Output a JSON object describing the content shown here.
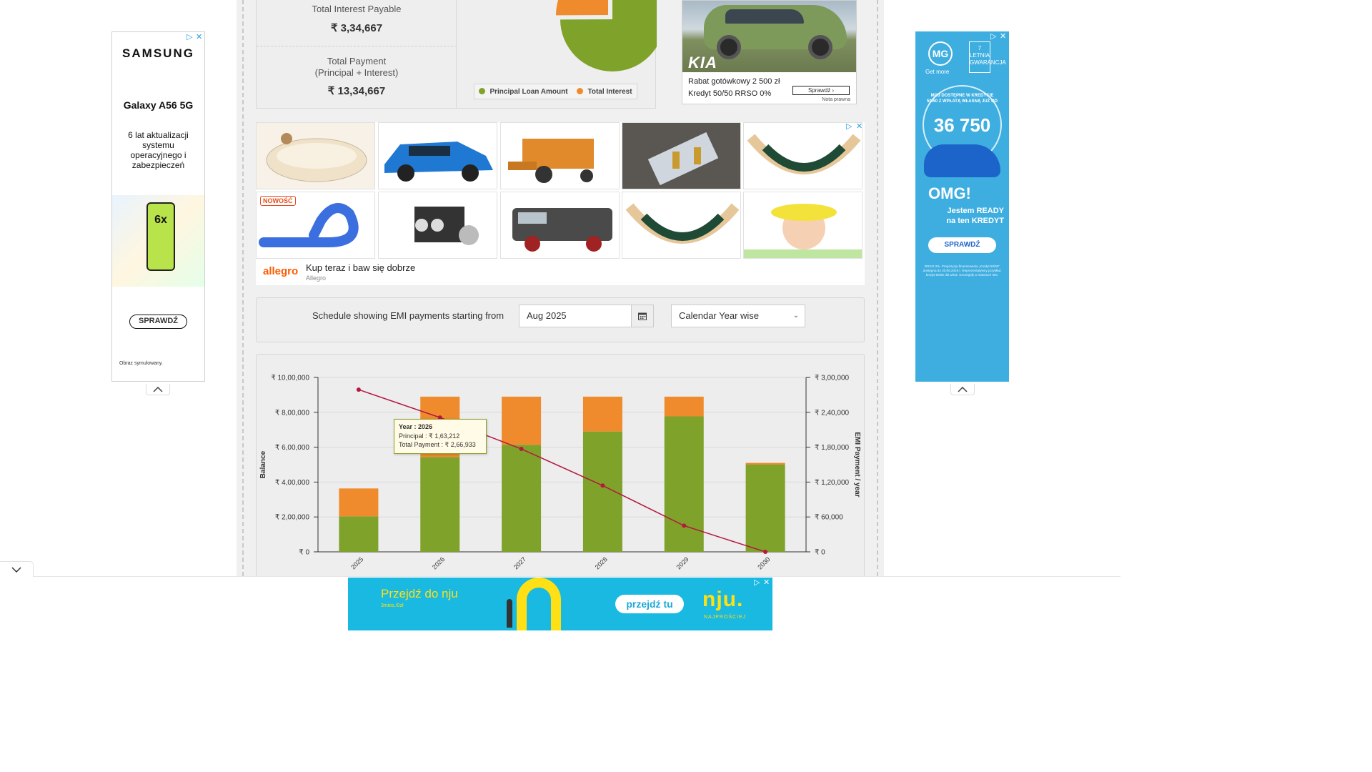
{
  "summary": {
    "interest_label": "Total Interest Payable",
    "interest_value": "₹ 3,34,667",
    "payment_label_line1": "Total Payment",
    "payment_label_line2": "(Principal + Interest)",
    "payment_value": "₹ 13,34,667",
    "legend_principal": "Principal Loan Amount",
    "legend_interest": "Total Interest",
    "pie": {
      "principal": 1000000,
      "interest": 334667
    }
  },
  "colors": {
    "principal": "#7fa22a",
    "interest": "#ef8b2c",
    "balance_line": "#b5193f"
  },
  "ads": {
    "kia": {
      "logo": "KIA",
      "line1": "Rabat gotówkowy 2 500 zł",
      "line2": "Kredyt 50/50 RRSO 0%",
      "button": "Sprawdź",
      "note": "Nota prawna"
    },
    "allegro": {
      "logo": "allegro",
      "title": "Kup teraz i baw się dobrze",
      "subtitle": "Allegro",
      "badge": "NOWOŚĆ"
    },
    "samsung": {
      "brand": "SAMSUNG",
      "model": "Galaxy A56 5G",
      "desc": "6 lat aktualizacji systemu operacyjnego i zabezpieczeń",
      "phone_text": "6x",
      "button": "SPRAWDŹ",
      "footnote": "Obraz symulowany."
    },
    "mg": {
      "logo": "MG",
      "getmore": "Get more",
      "badge": "7 LETNIA GWARANCJA",
      "small": "MG3 DOSTĘPNE W KREDYCIE 50/50 Z WPŁATĄ WŁASNĄ JUŻ OD",
      "big": "36 750",
      "omg": "OMG!",
      "ready_line1": "Jestem READY",
      "ready_line2": "na ten KREDYT",
      "button": "SPRAWDŹ",
      "fine": "RRSO 0%. Propozycja finansowania „Kredyt 50/50” dostępna do 30.09.2025 r. Reprezentatywny przykład: kredyt 50/50 dla MG3. Szczegóły w salonach MG."
    },
    "nju": {
      "headline": "Przejdź do nju",
      "price": "3mies./0zł",
      "button": "przejdź tu",
      "logo": "nju.",
      "tagline": "NAJPROŚCIEJ"
    }
  },
  "schedule": {
    "label": "Schedule showing EMI payments starting from",
    "start_value": "Aug 2025",
    "view_select": "Calendar Year wise"
  },
  "tooltip": {
    "year": "Year : 2026",
    "principal": "Principal : ₹ 1,63,212",
    "total": "Total Payment : ₹ 2,66,933"
  },
  "chart_data": {
    "type": "bar",
    "categories": [
      "2025",
      "2026",
      "2027",
      "2028",
      "2029",
      "2030"
    ],
    "series": [
      {
        "name": "Principal",
        "axis": "right",
        "values": [
          61000,
          163212,
          184000,
          207000,
          233000,
          150000
        ]
      },
      {
        "name": "Interest",
        "axis": "right",
        "values": [
          48000,
          103721,
          82933,
          59933,
          33933,
          3000
        ]
      },
      {
        "name": "Balance",
        "axis": "left",
        "type": "line",
        "values": [
          930000,
          770000,
          590000,
          380000,
          150000,
          0
        ]
      }
    ],
    "ylabel": "Balance",
    "y2label": "EMI Payment / year",
    "ylim": [
      0,
      1000000
    ],
    "y2lim": [
      0,
      300000
    ],
    "yticks": [
      "₹ 0",
      "₹ 2,00,000",
      "₹ 4,00,000",
      "₹ 6,00,000",
      "₹ 8,00,000",
      "₹ 10,00,000"
    ],
    "y2ticks": [
      "₹ 0",
      "₹ 60,000",
      "₹ 1,20,000",
      "₹ 1,80,000",
      "₹ 2,40,000",
      "₹ 3,00,000"
    ],
    "stacked": true,
    "grid": true
  }
}
